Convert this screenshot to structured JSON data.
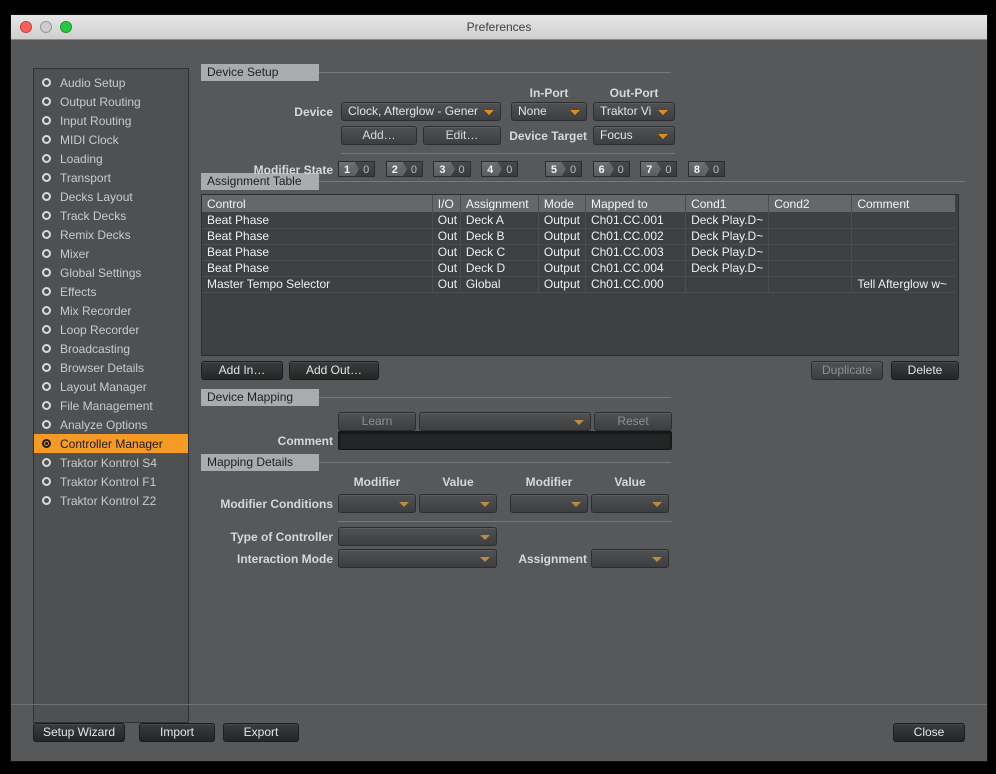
{
  "window": {
    "title": "Preferences",
    "traffic_lights": [
      "close-red",
      "minimize-gray",
      "zoom-green"
    ]
  },
  "sidebar": {
    "items": [
      {
        "label": "Audio Setup",
        "selected": false
      },
      {
        "label": "Output Routing",
        "selected": false
      },
      {
        "label": "Input Routing",
        "selected": false
      },
      {
        "label": "MIDI Clock",
        "selected": false
      },
      {
        "label": "Loading",
        "selected": false
      },
      {
        "label": "Transport",
        "selected": false
      },
      {
        "label": "Decks Layout",
        "selected": false
      },
      {
        "label": "Track Decks",
        "selected": false
      },
      {
        "label": "Remix Decks",
        "selected": false
      },
      {
        "label": "Mixer",
        "selected": false
      },
      {
        "label": "Global Settings",
        "selected": false
      },
      {
        "label": "Effects",
        "selected": false
      },
      {
        "label": "Mix Recorder",
        "selected": false
      },
      {
        "label": "Loop Recorder",
        "selected": false
      },
      {
        "label": "Broadcasting",
        "selected": false
      },
      {
        "label": "Browser Details",
        "selected": false
      },
      {
        "label": "Layout Manager",
        "selected": false
      },
      {
        "label": "File Management",
        "selected": false
      },
      {
        "label": "Analyze Options",
        "selected": false
      },
      {
        "label": "Controller Manager",
        "selected": true
      },
      {
        "label": "Traktor Kontrol S4",
        "selected": false
      },
      {
        "label": "Traktor Kontrol F1",
        "selected": false
      },
      {
        "label": "Traktor Kontrol Z2",
        "selected": false
      }
    ]
  },
  "device_setup": {
    "section_title": "Device Setup",
    "in_port_header": "In-Port",
    "out_port_header": "Out-Port",
    "device_label": "Device",
    "device_value": "Clock, Afterglow - Gener",
    "in_port_value": "None",
    "out_port_value": "Traktor Vi",
    "add_button": "Add…",
    "edit_button": "Edit…",
    "device_target_label": "Device Target",
    "device_target_value": "Focus",
    "modifier_state_label": "Modifier State",
    "modifiers": [
      {
        "n": "1",
        "v": "0"
      },
      {
        "n": "2",
        "v": "0"
      },
      {
        "n": "3",
        "v": "0"
      },
      {
        "n": "4",
        "v": "0"
      },
      {
        "n": "5",
        "v": "0"
      },
      {
        "n": "6",
        "v": "0"
      },
      {
        "n": "7",
        "v": "0"
      },
      {
        "n": "8",
        "v": "0"
      }
    ]
  },
  "assignment_table": {
    "section_title": "Assignment Table",
    "columns": [
      "Control",
      "I/O",
      "Assignment",
      "Mode",
      "Mapped to",
      "Cond1",
      "Cond2",
      "Comment"
    ],
    "rows": [
      {
        "control": "Beat Phase",
        "io": "Out",
        "assignment": "Deck A",
        "mode": "Output",
        "mapped_to": "Ch01.CC.001",
        "cond1": "Deck Play.D~",
        "cond2": "",
        "comment": ""
      },
      {
        "control": "Beat Phase",
        "io": "Out",
        "assignment": "Deck B",
        "mode": "Output",
        "mapped_to": "Ch01.CC.002",
        "cond1": "Deck Play.D~",
        "cond2": "",
        "comment": ""
      },
      {
        "control": "Beat Phase",
        "io": "Out",
        "assignment": "Deck C",
        "mode": "Output",
        "mapped_to": "Ch01.CC.003",
        "cond1": "Deck Play.D~",
        "cond2": "",
        "comment": ""
      },
      {
        "control": "Beat Phase",
        "io": "Out",
        "assignment": "Deck D",
        "mode": "Output",
        "mapped_to": "Ch01.CC.004",
        "cond1": "Deck Play.D~",
        "cond2": "",
        "comment": ""
      },
      {
        "control": "Master Tempo Selector",
        "io": "Out",
        "assignment": "Global",
        "mode": "Output",
        "mapped_to": "Ch01.CC.000",
        "cond1": "",
        "cond2": "",
        "comment": "Tell Afterglow w~"
      }
    ],
    "add_in_button": "Add In…",
    "add_out_button": "Add Out…",
    "duplicate_button": "Duplicate",
    "delete_button": "Delete"
  },
  "device_mapping": {
    "section_title": "Device Mapping",
    "learn_button": "Learn",
    "learn_dropdown_value": "",
    "reset_button": "Reset",
    "comment_label": "Comment",
    "comment_value": ""
  },
  "mapping_details": {
    "section_title": "Mapping Details",
    "modifier_header_1": "Modifier",
    "value_header_1": "Value",
    "modifier_header_2": "Modifier",
    "value_header_2": "Value",
    "modifier_conditions_label": "Modifier Conditions",
    "modifier_1_value": "",
    "value_1_value": "",
    "modifier_2_value": "",
    "value_2_value": "",
    "type_of_controller_label": "Type of Controller",
    "type_of_controller_value": "",
    "interaction_mode_label": "Interaction Mode",
    "interaction_mode_value": "",
    "assignment_label": "Assignment",
    "assignment_value": ""
  },
  "footer": {
    "setup_wizard": "Setup Wizard",
    "import": "Import",
    "export": "Export",
    "close": "Close"
  },
  "colors": {
    "accent_orange": "#f49a25",
    "dropdown_arrow": "#e08a1e",
    "background": "#565859",
    "panel": "#4e5051"
  }
}
